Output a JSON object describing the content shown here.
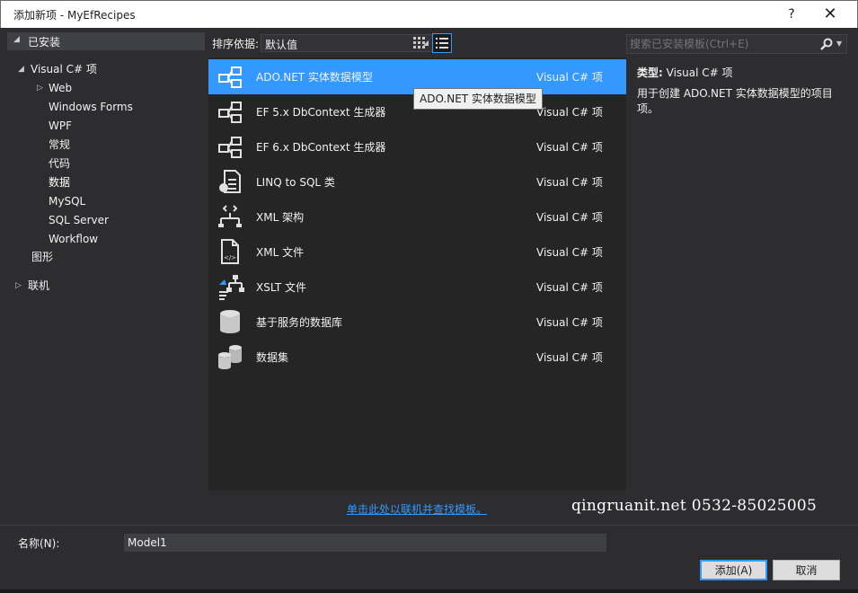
{
  "window": {
    "title": "添加新项 - MyEfRecipes",
    "help_label": "?",
    "close_label": "✕"
  },
  "left_panel": {
    "header": "已安装",
    "tree": [
      {
        "label": "Visual C# 项",
        "level": 0,
        "expanded": true
      },
      {
        "label": "Web",
        "level": 1,
        "collapsed": true
      },
      {
        "label": "Windows Forms",
        "level": 1
      },
      {
        "label": "WPF",
        "level": 1
      },
      {
        "label": "常规",
        "level": 1
      },
      {
        "label": "代码",
        "level": 1
      },
      {
        "label": "数据",
        "level": 1,
        "selected": true
      },
      {
        "label": "MySQL",
        "level": 1
      },
      {
        "label": "SQL Server",
        "level": 1
      },
      {
        "label": "Workflow",
        "level": 1
      },
      {
        "label": "图形",
        "level": 0
      },
      {
        "label": "联机",
        "level": 0,
        "collapsed": true
      }
    ]
  },
  "toolbar": {
    "sort_label": "排序依据:",
    "sort_value": "默认值"
  },
  "search": {
    "placeholder": "搜索已安装模板(Ctrl+E)"
  },
  "templates": [
    {
      "name": "ADO.NET 实体数据模型",
      "type": "Visual C# 项",
      "icon": "ado-entity-icon",
      "selected": true
    },
    {
      "name": "EF 5.x DbContext 生成器",
      "type": "Visual C# 项",
      "icon": "ef-generator-icon"
    },
    {
      "name": "EF 6.x DbContext 生成器",
      "type": "Visual C# 项",
      "icon": "ef-generator-icon"
    },
    {
      "name": "LINQ to SQL 类",
      "type": "Visual C# 项",
      "icon": "linq-sql-icon"
    },
    {
      "name": "XML 架构",
      "type": "Visual C# 项",
      "icon": "xml-schema-icon"
    },
    {
      "name": "XML 文件",
      "type": "Visual C# 项",
      "icon": "xml-file-icon"
    },
    {
      "name": "XSLT 文件",
      "type": "Visual C# 项",
      "icon": "xslt-file-icon"
    },
    {
      "name": "基于服务的数据库",
      "type": "Visual C# 项",
      "icon": "database-icon"
    },
    {
      "name": "数据集",
      "type": "Visual C# 项",
      "icon": "dataset-icon"
    }
  ],
  "tooltip": "ADO.NET 实体数据模型",
  "details": {
    "type_label": "类型:",
    "type_value": "Visual C# 项",
    "description": "用于创建 ADO.NET 实体数据模型的项目项。"
  },
  "online_link": "单击此处以联机并查找模板。",
  "watermark": "qingruanit.net 0532-85025005",
  "name_field": {
    "label": "名称(N):",
    "value": "Model1"
  },
  "buttons": {
    "add": "添加(A)",
    "cancel": "取消"
  },
  "colors": {
    "accent": "#3399ff",
    "background": "#2d2d30",
    "list_background": "#252526"
  }
}
